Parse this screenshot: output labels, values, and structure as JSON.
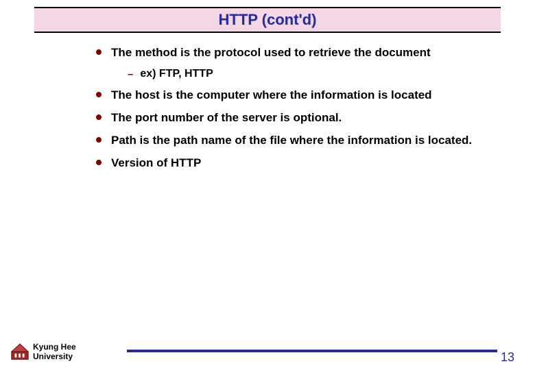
{
  "title": "HTTP (cont'd)",
  "bullets": {
    "b0": "The method is the protocol used to retrieve the document",
    "b0_sub": "ex)  FTP,  HTTP",
    "b1": "The host is the computer where the information is located",
    "b2": "The port number of the server is optional.",
    "b3": "Path is the path name of the file where the information is located.",
    "b4": "Version of HTTP"
  },
  "footer": {
    "university_line1": "Kyung Hee",
    "university_line2": "University",
    "page_number": "13"
  }
}
